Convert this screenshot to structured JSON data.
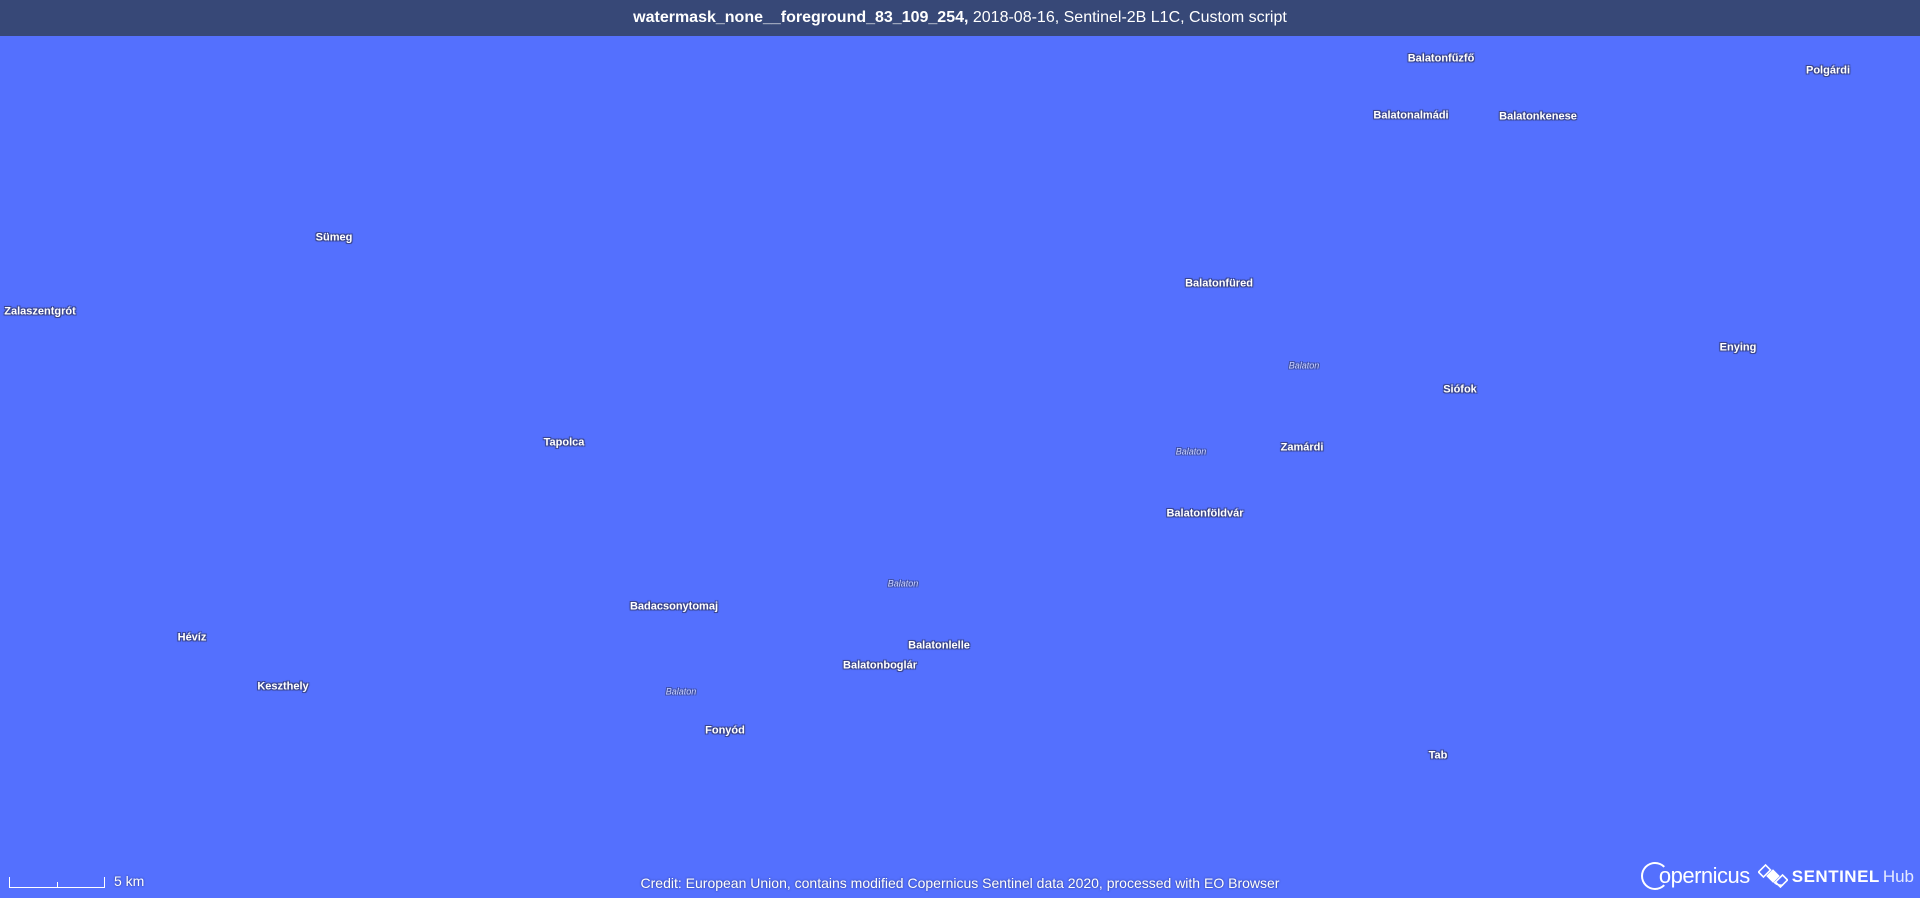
{
  "header": {
    "title": "watermask_none__foreground_83_109_254,",
    "meta": " 2018-08-16, Sentinel-2B L1C, Custom script"
  },
  "map": {
    "background_color": "#5470fe",
    "cities": [
      "Balatonfűzfő",
      "Polgárdi",
      "Balatonalmádi",
      "Balatonkenese",
      "Sümeg",
      "Balatonfüred",
      "Zalaszentgrót",
      "Enying",
      "Siófok",
      "Tapolca",
      "Zamárdi",
      "Balatonföldvár",
      "Badacsonytomaj",
      "Hévíz",
      "Balatonlelle",
      "Balatonboglár",
      "Keszthely",
      "Fonyód",
      "Tab"
    ],
    "water_labels": [
      "Balaton",
      "Balaton",
      "Balaton",
      "Balaton"
    ]
  },
  "footer": {
    "credit": "Credit: European Union, contains modified Copernicus Sentinel data 2020, processed with EO Browser",
    "scale_label": "5 km",
    "logo_copernicus": "opernicus",
    "logo_sentinel_main": "SENTINEL",
    "logo_sentinel_hub": "Hub"
  },
  "icons": {
    "copernicus": "copernicus-logo-icon",
    "sentinel": "satellite-icon"
  }
}
